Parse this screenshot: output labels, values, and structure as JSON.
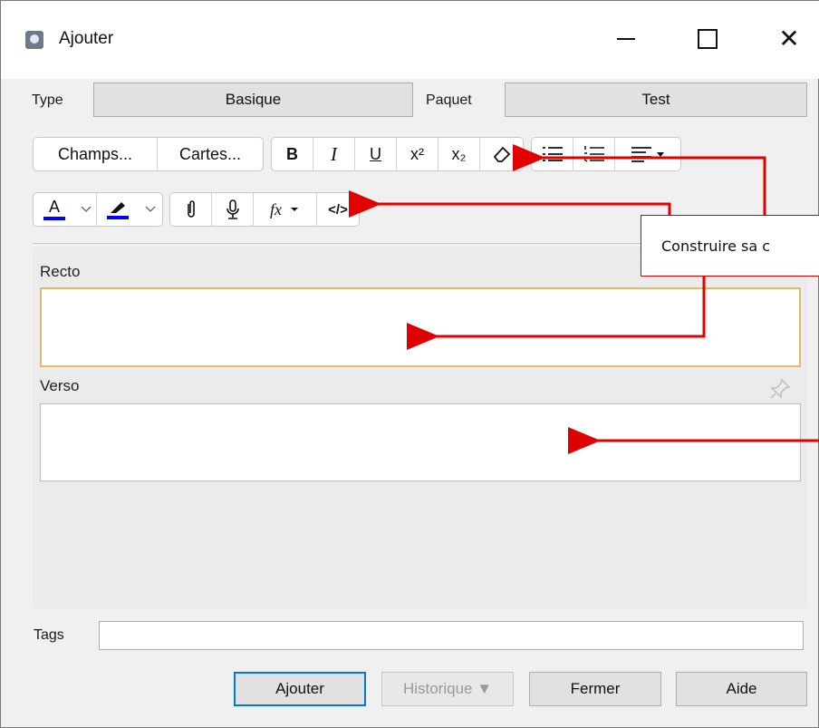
{
  "window": {
    "title": "Ajouter"
  },
  "top_row": {
    "type_label": "Type",
    "type_value": "Basique",
    "deck_label": "Paquet",
    "deck_value": "Test"
  },
  "toolbar": {
    "fields_btn": "Champs...",
    "cards_btn": "Cartes...",
    "bold": "B",
    "italic": "I",
    "underline": "U",
    "superscript": "x²",
    "subscript": "x₂",
    "text_color": "A",
    "mathjax": "fx",
    "html_editor": "</>"
  },
  "fields": [
    {
      "label": "Recto",
      "value": ""
    },
    {
      "label": "Verso",
      "value": ""
    }
  ],
  "tags": {
    "label": "Tags",
    "value": ""
  },
  "buttons": {
    "add": "Ajouter",
    "history": "Historique ▼",
    "close": "Fermer",
    "help": "Aide"
  },
  "annotation": {
    "callout_text": "Construire sa c"
  },
  "colors": {
    "annotation_red": "#e00000",
    "focus_border": "#e4b867",
    "default_button_border": "#0078d7",
    "text_color_underline": "#0000ff"
  }
}
